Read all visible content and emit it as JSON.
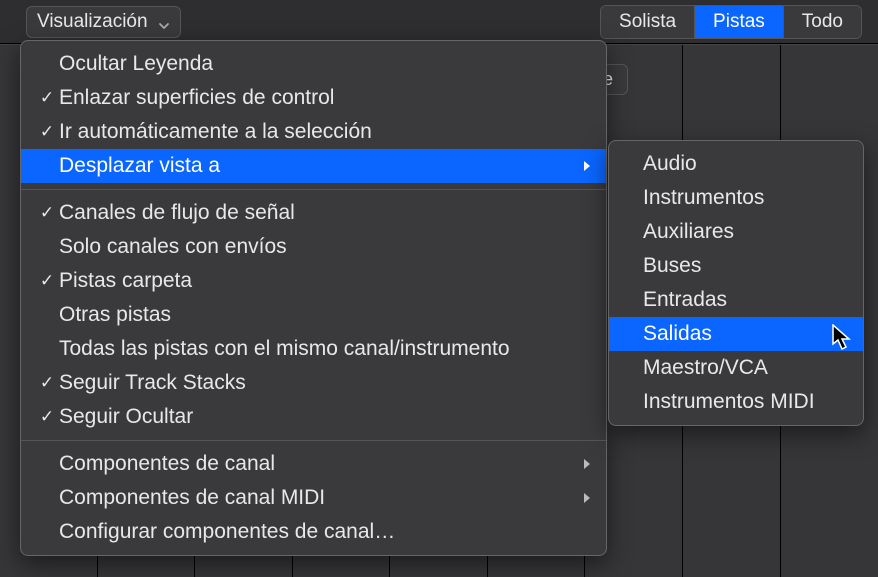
{
  "topbar": {
    "visualization_label": "Visualización",
    "seg": {
      "solo": "Solista",
      "tracks": "Pistas",
      "all": "Todo"
    }
  },
  "partial_button": "uste",
  "menu": {
    "hide_legend": "Ocultar Leyenda",
    "link_surfaces": "Enlazar superficies de control",
    "auto_goto_selection": "Ir automáticamente a la selección",
    "scroll_view_to": "Desplazar vista a",
    "signal_flow_channels": "Canales de flujo de señal",
    "only_channels_with_sends": "Solo canales con envíos",
    "folder_tracks": "Pistas carpeta",
    "other_tracks": "Otras pistas",
    "all_tracks_same_channel": "Todas las pistas con el mismo canal/instrumento",
    "follow_track_stacks": "Seguir Track Stacks",
    "follow_hide": "Seguir Ocultar",
    "channel_components": "Componentes de canal",
    "channel_components_midi": "Componentes de canal MIDI",
    "configure_channel_components": "Configurar componentes de canal…"
  },
  "submenu": {
    "audio": "Audio",
    "instruments": "Instrumentos",
    "auxiliaries": "Auxiliares",
    "buses": "Buses",
    "inputs": "Entradas",
    "outputs": "Salidas",
    "master_vca": "Maestro/VCA",
    "midi_instruments": "Instrumentos MIDI"
  }
}
